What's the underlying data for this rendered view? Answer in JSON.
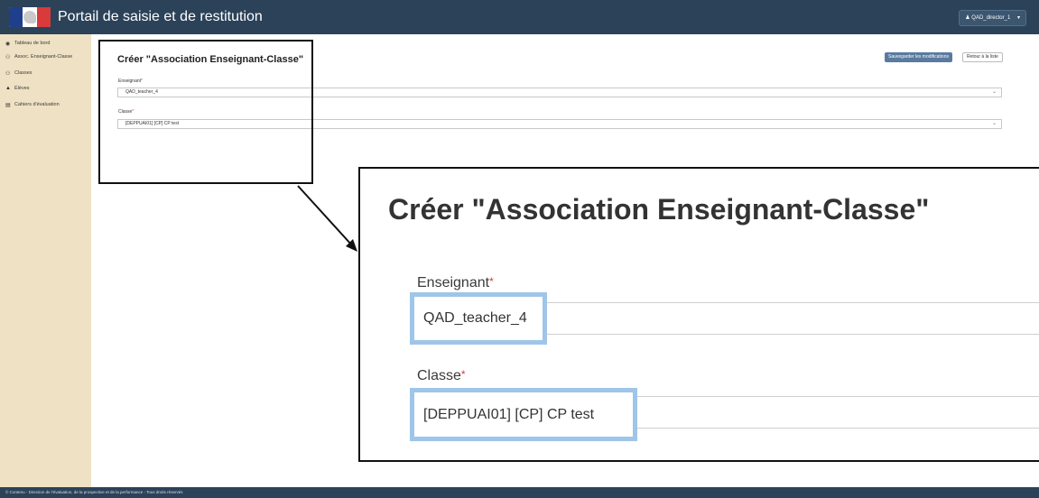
{
  "header": {
    "app_title": "Portail de saisie et de restitution",
    "user_label": "QAD_director_1",
    "user_caret": "▾"
  },
  "sidebar": {
    "items": [
      {
        "label": "Tableau de bord",
        "icon": "dashboard-icon",
        "glyph": "◉"
      },
      {
        "label": "Assoc. Enseignant-Classe",
        "icon": "users-icon",
        "glyph": "⚇"
      },
      {
        "label": "Classes",
        "icon": "users-icon",
        "glyph": "⚇"
      },
      {
        "label": "Élèves",
        "icon": "graduation-cap-icon",
        "glyph": "▲"
      },
      {
        "label": "Cahiers d'évaluation",
        "icon": "document-icon",
        "glyph": "▤"
      }
    ]
  },
  "main": {
    "title": "Créer \"Association Enseignant-Classe\"",
    "save_button": "Sauvegarder les modifications",
    "back_button": "Retour à la liste",
    "teacher": {
      "label": "Enseignant",
      "value": "QAD_teacher_4"
    },
    "classe": {
      "label": "Classe",
      "value": "[DEPPUAI01] [CP] CP test"
    },
    "required_mark": "*",
    "chevron": "⌄"
  },
  "zoom": {
    "title": "Créer \"Association Enseignant-Classe\"",
    "teacher_label": "Enseignant",
    "teacher_value": "QAD_teacher_4",
    "classe_label": "Classe",
    "classe_value": "[DEPPUAI01] [CP] CP test",
    "highlight_color": "#9fc5e8"
  },
  "footer": {
    "text": "© Contenu - Direction de l'évaluation, de la prospective et de la performance - Tous droits réservés"
  },
  "colors": {
    "topbar": "#2b4259",
    "sidebar": "#efe1c4",
    "primary_button": "#5a7b9f",
    "required": "#d93a3a"
  }
}
